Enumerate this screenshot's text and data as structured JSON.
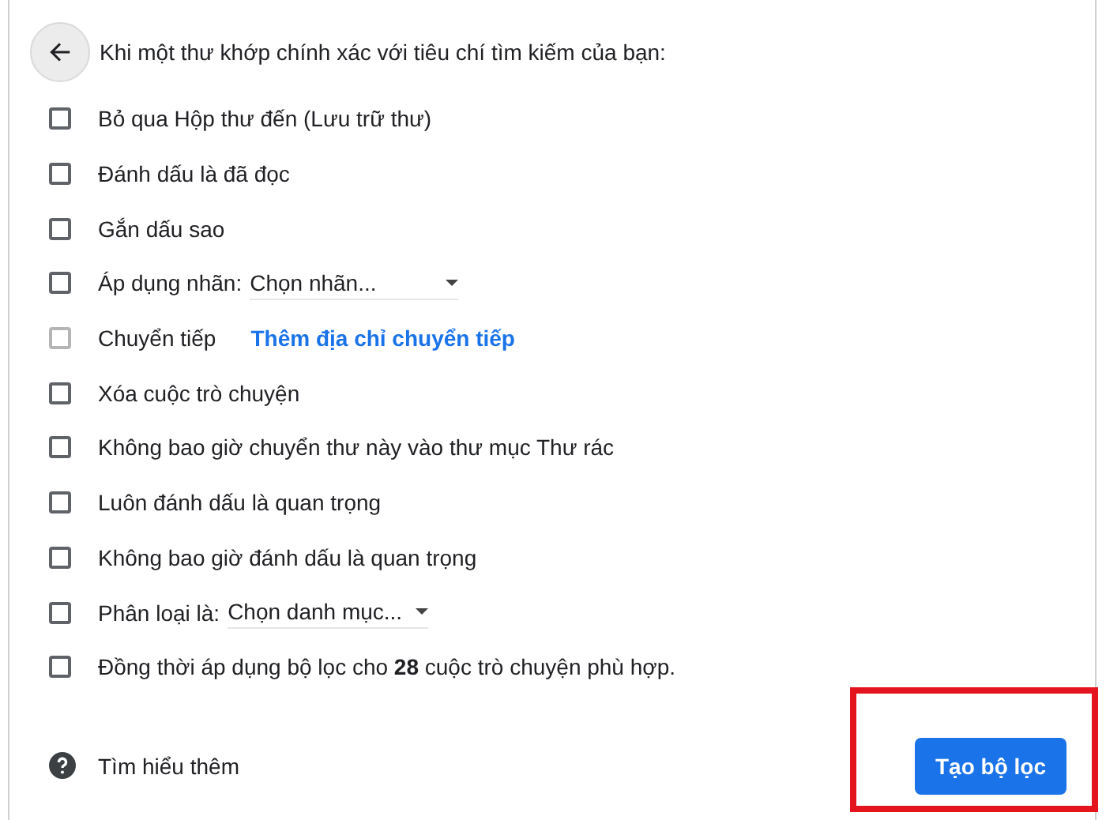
{
  "header": {
    "title": "Khi một thư khớp chính xác với tiêu chí tìm kiếm của bạn:"
  },
  "actions": [
    {
      "kind": "plain",
      "label": "Bỏ qua Hộp thư đến (Lưu trữ thư)",
      "checked": false,
      "disabled": false
    },
    {
      "kind": "plain",
      "label": "Đánh dấu là đã đọc",
      "checked": false,
      "disabled": false
    },
    {
      "kind": "plain",
      "label": "Gắn dấu sao",
      "checked": false,
      "disabled": false
    },
    {
      "kind": "select",
      "label": "Áp dụng nhãn:",
      "value": "Chọn nhãn...",
      "checked": false,
      "disabled": false
    },
    {
      "kind": "link",
      "label": "Chuyển tiếp",
      "link": "Thêm địa chỉ chuyển tiếp",
      "checked": false,
      "disabled": true
    },
    {
      "kind": "plain",
      "label": "Xóa cuộc trò chuyện",
      "checked": false,
      "disabled": false
    },
    {
      "kind": "plain",
      "label": "Không bao giờ chuyển thư này vào thư mục Thư rác",
      "checked": false,
      "disabled": false
    },
    {
      "kind": "plain",
      "label": "Luôn đánh dấu là quan trọng",
      "checked": false,
      "disabled": false
    },
    {
      "kind": "plain",
      "label": "Không bao giờ đánh dấu là quan trọng",
      "checked": false,
      "disabled": false
    },
    {
      "kind": "select",
      "label": "Phân loại là:",
      "value": "Chọn danh mục...",
      "checked": false,
      "disabled": false
    },
    {
      "kind": "plain",
      "label": "Đồng thời áp dụng bộ lọc cho **28** cuộc trò chuyện phù hợp.",
      "checked": false,
      "disabled": false
    }
  ],
  "footer": {
    "help_link": "Tìm hiểu thêm",
    "button": "Tạo bộ lọc"
  }
}
